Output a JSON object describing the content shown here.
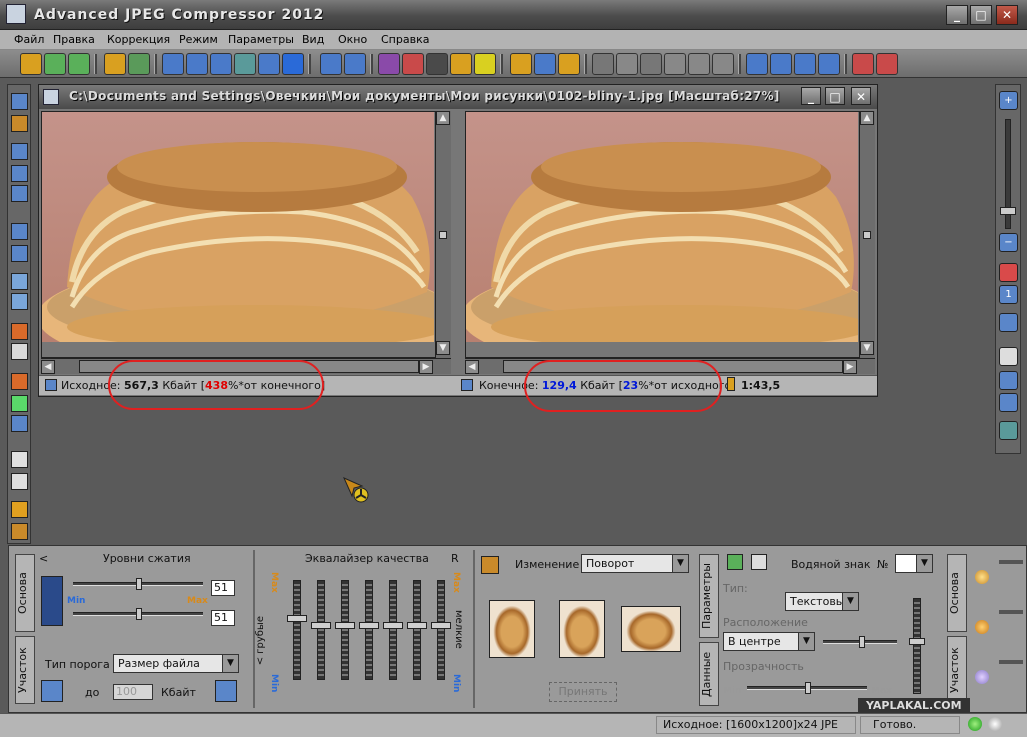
{
  "window": {
    "title": "Advanced JPEG Compressor 2012",
    "icon_label": "",
    "min_glyph": "_",
    "max_glyph": "□",
    "close_glyph": "✕"
  },
  "menu": [
    "Файл",
    "Правка",
    "Коррекция",
    "Режим",
    "Параметры",
    "Вид",
    "Окно",
    "Справка"
  ],
  "toolbar": {
    "icons": [
      "open-icon",
      "refresh-icon",
      "batch-icon",
      "open-folder-icon",
      "play-icon",
      "save-icon",
      "save-as-icon",
      "save-all-icon",
      "email-icon",
      "info-icon",
      "help-icon",
      "copy-icon",
      "paste-icon",
      "crop-icon",
      "resize-icon",
      "preview-eye-icon",
      "brush-icon",
      "check-icon",
      "hand-icon",
      "pointer-icon",
      "hand-pointer-icon",
      "select-rect-icon",
      "select-circle-icon",
      "magic-wand-icon",
      "zoom-view-icon",
      "stamp-icon",
      "undo-icon",
      "tile-horizontal-icon",
      "tile-vertical-icon",
      "tile-columns-icon",
      "tile-grid-icon",
      "close-window-icon",
      "export-icon"
    ]
  },
  "document": {
    "title": "C:\\Documents and Settings\\Овечкин\\Мои документы\\Мои рисунки\\0102-bliny-1.jpg  [Масштаб:27%]",
    "source_status": {
      "label": "Исходное:",
      "size": "567,3",
      "unit": "Кбайт",
      "percent": "438",
      "suffix": "%*от конечного",
      "open_bracket": "[",
      "close_bracket": "]"
    },
    "result_status": {
      "label": "Конечное:",
      "size": "129,4",
      "unit": "Кбайт",
      "percent": "23",
      "suffix": "%*от исходного",
      "open_bracket": "[",
      "close_bracket": "]"
    },
    "ratio": "1:43,5"
  },
  "compression": {
    "lt_glyph": "<",
    "title": "Уровни сжатия",
    "min_label": "Min",
    "max_label": "Max",
    "value1": "51",
    "value2": "51",
    "level1_fraction": 0.51,
    "level2_fraction": 0.51,
    "threshold_label": "Тип порога",
    "threshold_value": "Размер файла",
    "to_label": "до",
    "size_value": "100",
    "size_unit": "Кбайт"
  },
  "equalizer": {
    "title": "Эквалайзер качества",
    "r_label": "R",
    "max_label": "Max",
    "min_label": "Min",
    "left_axis": "< грубые",
    "right_axis": "мелкие",
    "bands": [
      0.62,
      0.55,
      0.55,
      0.55,
      0.55,
      0.55,
      0.55
    ]
  },
  "transform": {
    "label": "Изменение",
    "value": "Поворот",
    "apply_button": "Принять"
  },
  "watermark": {
    "label": "Водяной знак",
    "number_label": "№",
    "type_label": "Тип:",
    "type_value": "Текстовы",
    "position_label": "Расположение",
    "position_value": "В центре",
    "transparency_label": "Прозрачность",
    "min_label": "Min",
    "max_label": "Max"
  },
  "tabs": {
    "left_top": "Основа",
    "left_bottom": "Участок",
    "mid_top": "Параметры",
    "mid_bottom": "Данные",
    "right_top": "Основа",
    "right_bottom": "Участок"
  },
  "statusbar": {
    "info": "Исходное: [1600x1200]x24 JPE",
    "state": "Готово."
  },
  "watermark_site": "YAPLAKAL.COM"
}
